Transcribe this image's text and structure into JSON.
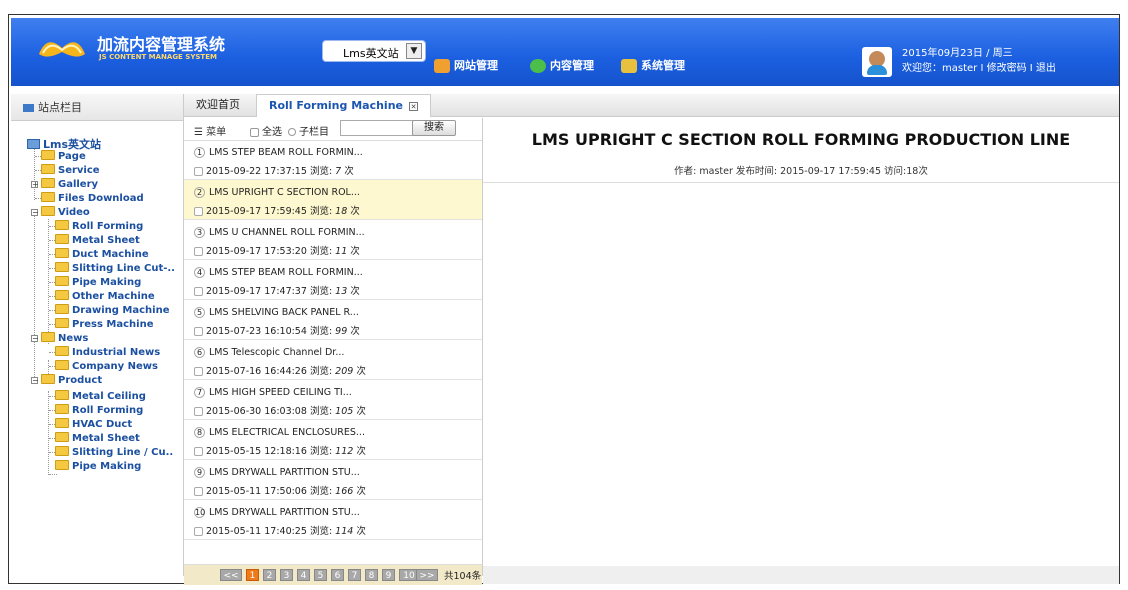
{
  "header": {
    "brand": "加流内容管理系统",
    "brand_sub": "JS CONTENT MANAGE SYSTEM",
    "site_select": "Lms英文站",
    "nav": [
      "网站管理",
      "内容管理",
      "系统管理"
    ],
    "date": "2015年09月23日 / 周三",
    "user_line": "欢迎您：master  I  修改密码 I 退出"
  },
  "left": {
    "title": "站点栏目",
    "root": "Lms英文站",
    "page": "Page",
    "service": "Service",
    "gallery": "Gallery",
    "files": "Files Download",
    "video": "Video",
    "v1": "Roll Forming",
    "v2": "Metal Sheet",
    "v3": "Duct Machine",
    "v4": "Slitting Line Cut-..",
    "v5": "Pipe Making",
    "v6": "Other Machine",
    "v7": "Drawing Machine",
    "v8": "Press Machine",
    "news": "News",
    "n1": "Industrial News",
    "n2": "Company News",
    "product": "Product",
    "p1": "Metal Ceiling",
    "p2": "Roll Forming",
    "p3": "HVAC Duct",
    "p4": "Metal Sheet",
    "p5": "Slitting Line / Cu..",
    "p6": "Pipe Making"
  },
  "tabs": {
    "home": "欢迎首页",
    "current": "Roll Forming Machine"
  },
  "toolbar": {
    "menu": "☰ 菜单",
    "select_all": "全选",
    "sub_column": "子栏目",
    "search": "搜索"
  },
  "items": [
    {
      "n": "1",
      "title": "LMS STEP BEAM ROLL FORMIN...",
      "date": "2015-09-22 17:37:15",
      "views_label": "浏览:",
      "views": "7",
      "unit": "次"
    },
    {
      "n": "2",
      "title": "LMS UPRIGHT C SECTION ROL...",
      "date": "2015-09-17 17:59:45",
      "views_label": "浏览:",
      "views": "18",
      "unit": "次"
    },
    {
      "n": "3",
      "title": "LMS U CHANNEL ROLL FORMIN...",
      "date": "2015-09-17 17:53:20",
      "views_label": "浏览:",
      "views": "11",
      "unit": "次"
    },
    {
      "n": "4",
      "title": "LMS STEP BEAM ROLL FORMIN...",
      "date": "2015-09-17 17:47:37",
      "views_label": "浏览:",
      "views": "13",
      "unit": "次"
    },
    {
      "n": "5",
      "title": "LMS SHELVING BACK PANEL R...",
      "date": "2015-07-23 16:10:54",
      "views_label": "浏览:",
      "views": "99",
      "unit": "次"
    },
    {
      "n": "6",
      "title": "LMS Telescopic Channel Dr...",
      "date": "2015-07-16 16:44:26",
      "views_label": "浏览:",
      "views": "209",
      "unit": "次"
    },
    {
      "n": "7",
      "title": "LMS HIGH SPEED CEILING TI...",
      "date": "2015-06-30 16:03:08",
      "views_label": "浏览:",
      "views": "105",
      "unit": "次"
    },
    {
      "n": "8",
      "title": "LMS ELECTRICAL ENCLOSURES...",
      "date": "2015-05-15 12:18:16",
      "views_label": "浏览:",
      "views": "112",
      "unit": "次"
    },
    {
      "n": "9",
      "title": "LMS DRYWALL PARTITION STU...",
      "date": "2015-05-11 17:50:06",
      "views_label": "浏览:",
      "views": "166",
      "unit": "次"
    },
    {
      "n": "10",
      "title": "LMS DRYWALL PARTITION STU...",
      "date": "2015-05-11 17:40:25",
      "views_label": "浏览:",
      "views": "114",
      "unit": "次"
    }
  ],
  "pager": {
    "prev": "<<",
    "pages": [
      "1",
      "2",
      "3",
      "4",
      "5",
      "6",
      "7",
      "8",
      "9",
      "10"
    ],
    "next": ">>",
    "total": "共104条"
  },
  "article": {
    "title": "LMS UPRIGHT C SECTION ROLL FORMING PRODUCTION LINE",
    "meta": "作者: master 发布时间: 2015-09-17 17:59:45 访问:18次"
  }
}
